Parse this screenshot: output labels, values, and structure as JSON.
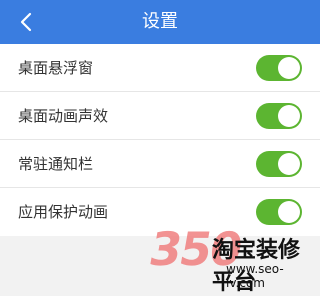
{
  "header": {
    "title": "设置",
    "background_color": "#3a7de0",
    "back_icon": "chevron-left-icon"
  },
  "settings": [
    {
      "label": "桌面悬浮窗",
      "enabled": true
    },
    {
      "label": "桌面动画声效",
      "enabled": true
    },
    {
      "label": "常驻通知栏",
      "enabled": true
    },
    {
      "label": "应用保护动画",
      "enabled": true
    }
  ],
  "colors": {
    "toggle_on": "#5cb531",
    "page_background": "#f2f2f2"
  },
  "watermark": {
    "number": "350",
    "brand": "淘宝装修平台",
    "url": "www.seo-lv.com"
  }
}
